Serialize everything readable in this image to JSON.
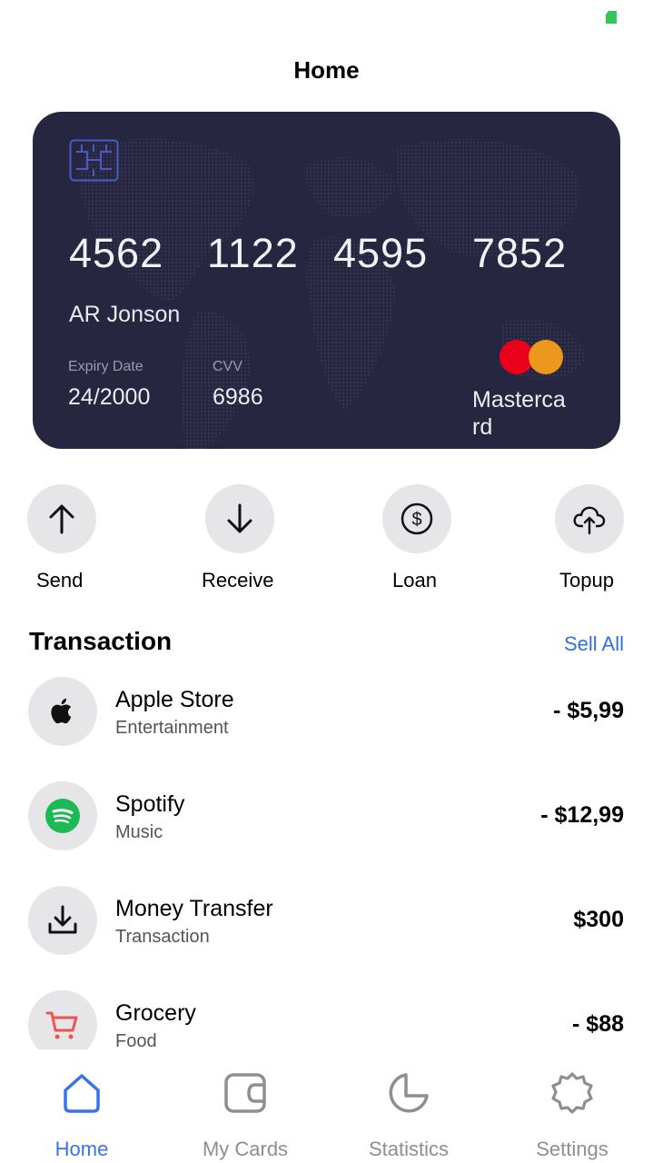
{
  "header": {
    "title": "Home"
  },
  "card": {
    "number_groups": [
      "4562",
      "1122",
      "4595",
      "7852"
    ],
    "holder": "AR Jonson",
    "expiry_label": "Expiry Date",
    "expiry_value": "24/2000",
    "cvv_label": "CVV",
    "cvv_value": "6986",
    "brand": "Mastercard",
    "background_color": "#262640"
  },
  "actions": [
    {
      "label": "Send",
      "icon": "arrow-up-icon"
    },
    {
      "label": "Receive",
      "icon": "arrow-down-icon"
    },
    {
      "label": "Loan",
      "icon": "dollar-coin-icon"
    },
    {
      "label": "Topup",
      "icon": "cloud-upload-icon"
    }
  ],
  "transactions": {
    "heading": "Transaction",
    "see_all": "Sell All",
    "items": [
      {
        "name": "Apple Store",
        "category": "Entertainment",
        "amount": "- $5,99",
        "icon": "apple-icon"
      },
      {
        "name": "Spotify",
        "category": "Music",
        "amount": "- $12,99",
        "icon": "spotify-icon"
      },
      {
        "name": "Money Transfer",
        "category": "Transaction",
        "amount": "$300",
        "icon": "download-icon"
      },
      {
        "name": "Grocery",
        "category": "Food",
        "amount": "- $88",
        "icon": "cart-icon"
      }
    ]
  },
  "nav": {
    "items": [
      {
        "label": "Home",
        "icon": "home-icon",
        "active": true
      },
      {
        "label": "My Cards",
        "icon": "wallet-icon",
        "active": false
      },
      {
        "label": "Statistics",
        "icon": "pie-chart-icon",
        "active": false
      },
      {
        "label": "Settings",
        "icon": "gear-icon",
        "active": false
      }
    ]
  },
  "colors": {
    "accent": "#3a73e8",
    "link": "#2f6fe0",
    "battery": "#34c759"
  }
}
